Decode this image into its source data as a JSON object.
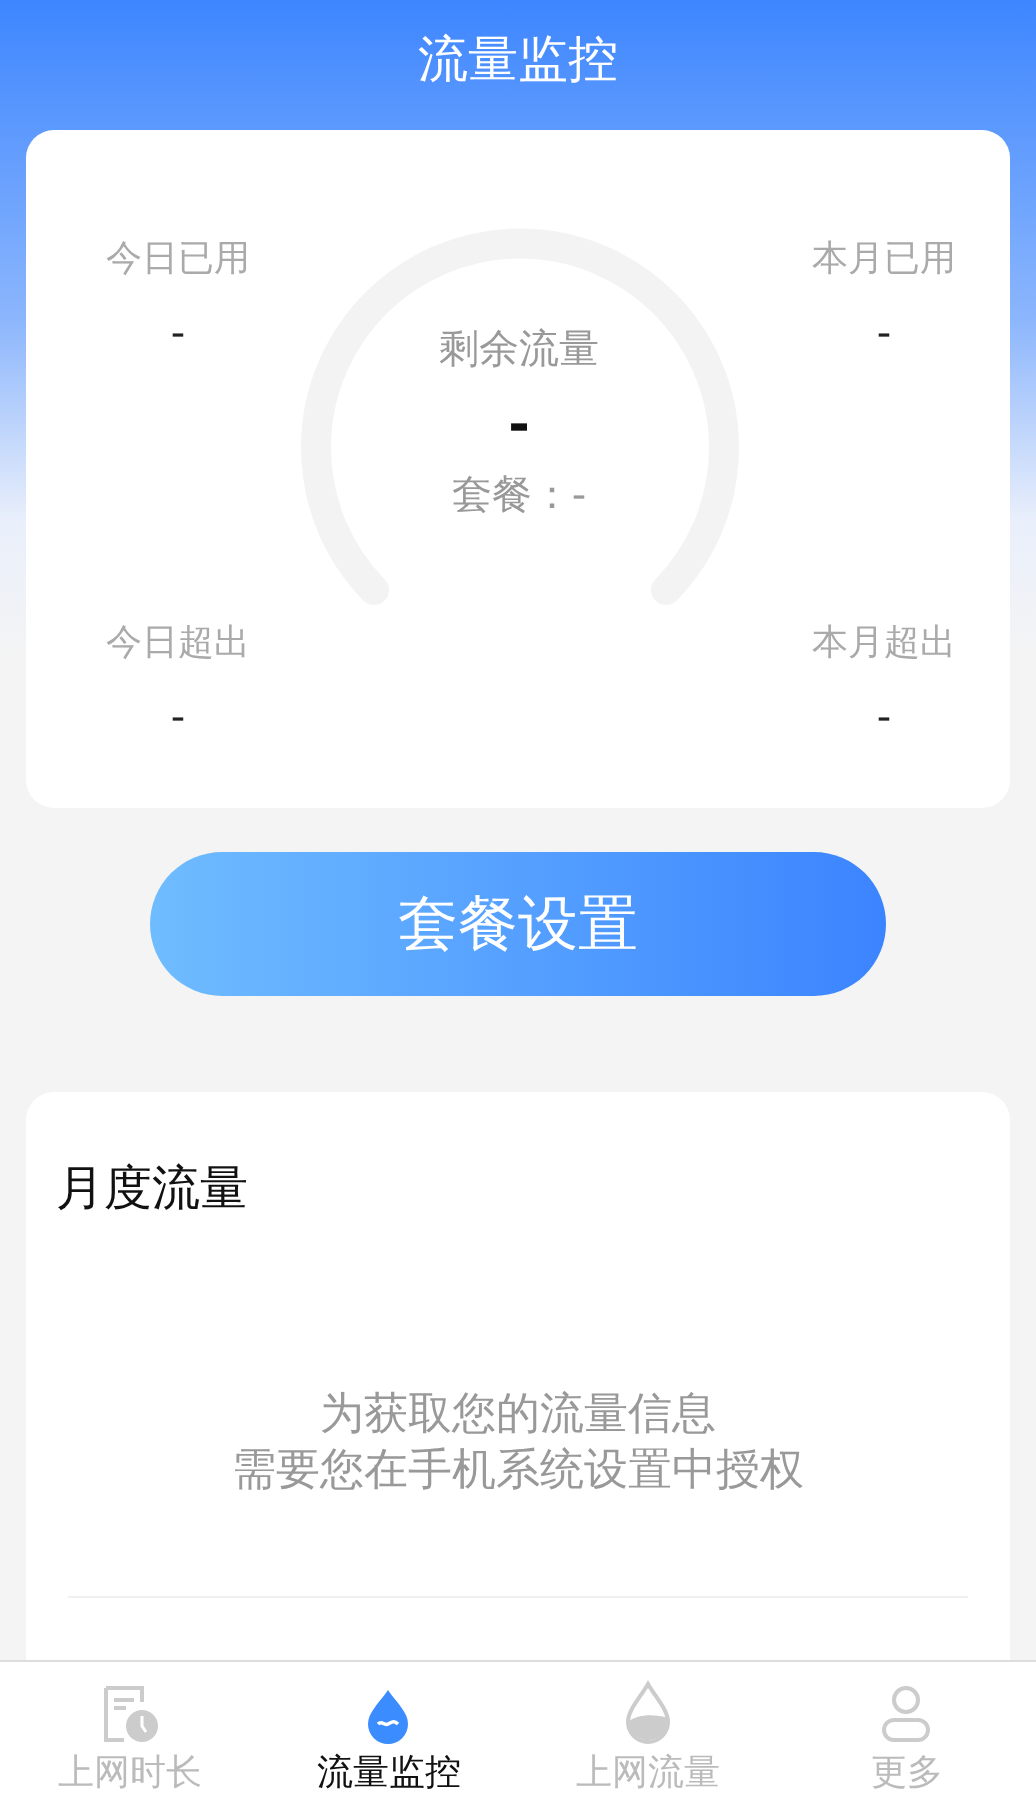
{
  "header": {
    "title": "流量监控"
  },
  "summary": {
    "stats": [
      {
        "label": "今日已用",
        "value": "-"
      },
      {
        "label": "本月已用",
        "value": "-"
      },
      {
        "label": "今日超出",
        "value": "-"
      },
      {
        "label": "本月超出",
        "value": "-"
      }
    ],
    "gauge": {
      "label": "剩余流量",
      "value": "-",
      "plan": "套餐：-"
    }
  },
  "plan_button": "套餐设置",
  "monthly": {
    "title": "月度流量",
    "notice": [
      "为获取您的流量信息",
      "需要您在手机系统设置中授权"
    ]
  },
  "tabs": [
    {
      "label": "上网时长",
      "kind": "clock",
      "selected": false
    },
    {
      "label": "流量监控",
      "kind": "drop",
      "selected": true
    },
    {
      "label": "上网流量",
      "kind": "half",
      "selected": false
    },
    {
      "label": "更多",
      "kind": "user",
      "selected": false
    }
  ]
}
